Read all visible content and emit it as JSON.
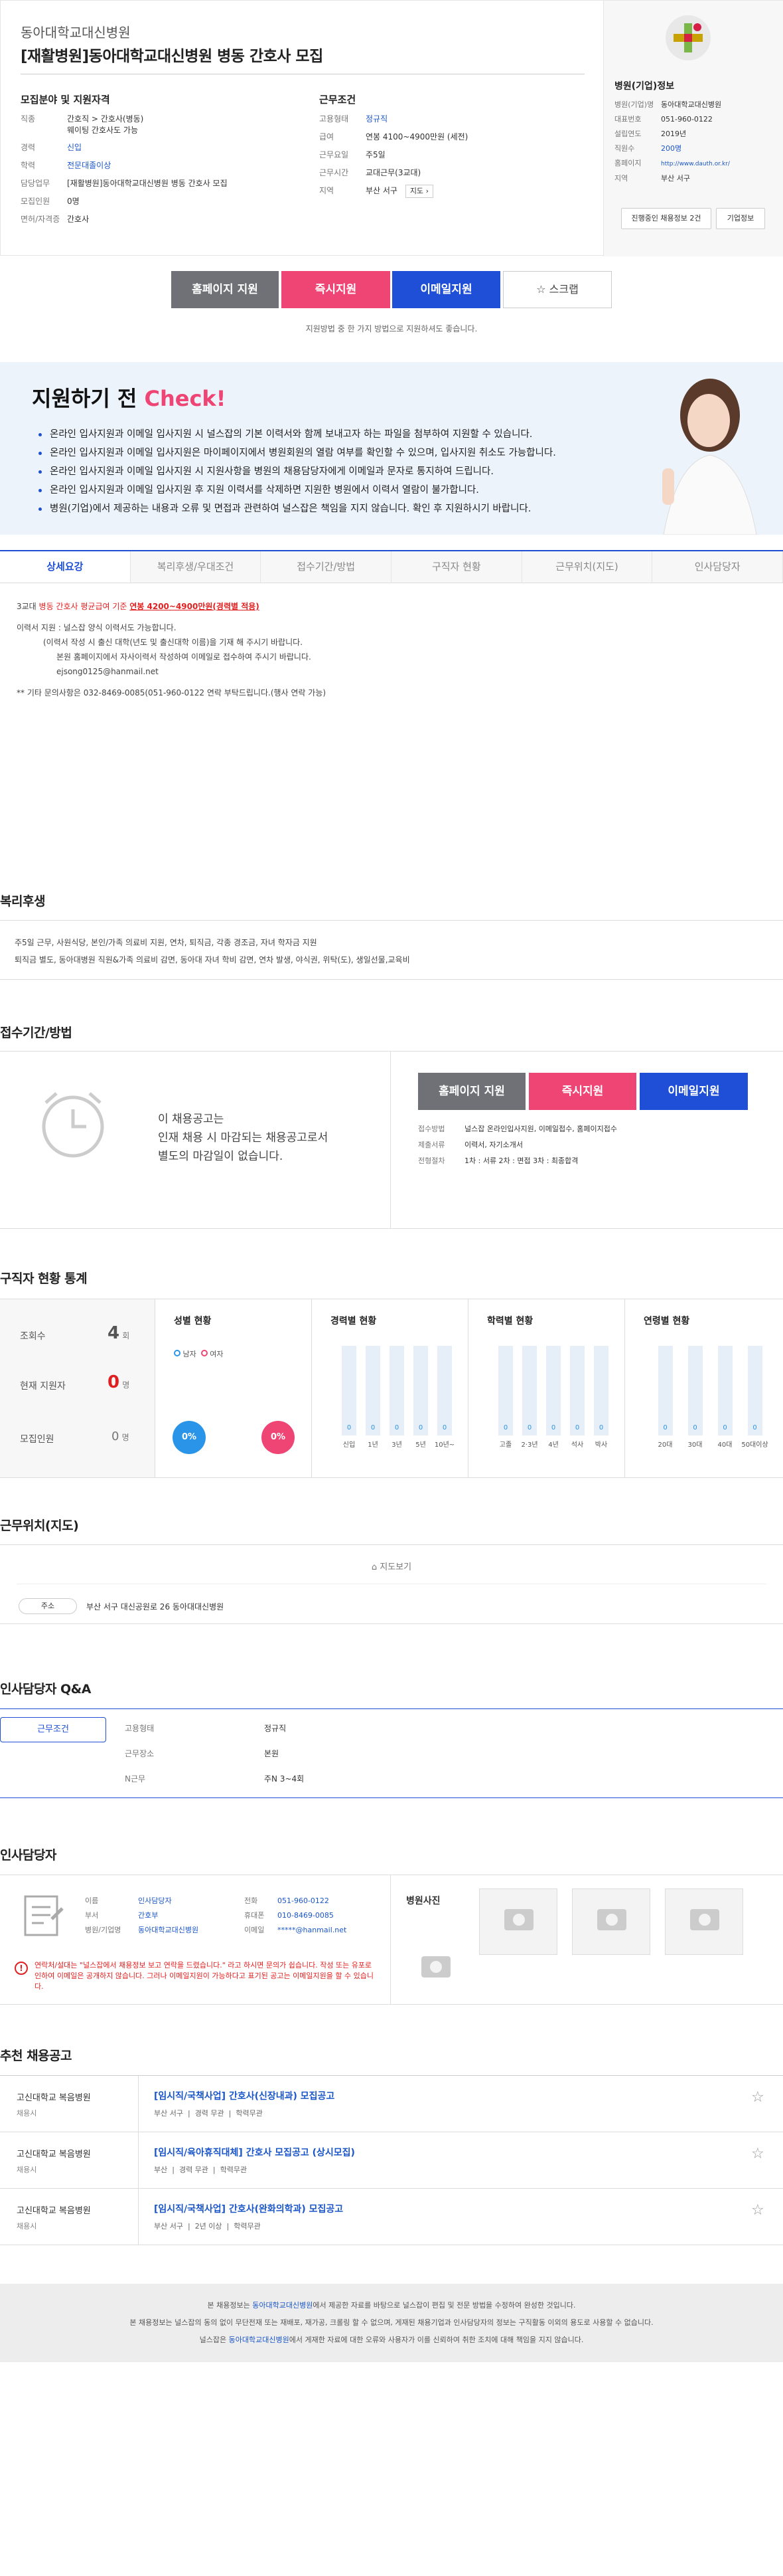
{
  "header": {
    "company": "동아대학교대신병원",
    "title": "[재활병원]동아대학교대신병원 병동 간호사 모집"
  },
  "qual": {
    "heading": "모집분야 및 지원자격",
    "rows": [
      {
        "k": "직종",
        "v": "간호직 > 간호사(병동)",
        "v2": "웨이팅 간호사도 가능"
      },
      {
        "k": "경력",
        "v": "신입"
      },
      {
        "k": "학력",
        "v": "전문대졸이상"
      },
      {
        "k": "담당업무",
        "v": "[재활병원]동아대학교대신병원 병동 간호사 모집"
      },
      {
        "k": "모집인원",
        "v": "0명"
      },
      {
        "k": "면허/자격증",
        "v": "간호사"
      }
    ]
  },
  "cond": {
    "heading": "근무조건",
    "rows": [
      {
        "k": "고용형태",
        "v": "정규직"
      },
      {
        "k": "급여",
        "v": "연봉 4100~4900만원 (세전)"
      },
      {
        "k": "근무요일",
        "v": "주5일"
      },
      {
        "k": "근무시간",
        "v": "교대근무(3교대)"
      },
      {
        "k": "지역",
        "v": "부산 서구",
        "btn": "지도"
      }
    ]
  },
  "hospital": {
    "heading": "병원(기업)정보",
    "rows": [
      {
        "k": "병원(기업)명",
        "v": "동아대학교대신병원"
      },
      {
        "k": "대표번호",
        "v": "051-960-0122"
      },
      {
        "k": "설립연도",
        "v": "2019년"
      },
      {
        "k": "직원수",
        "v": "200명"
      },
      {
        "k": "홈페이지",
        "v": "http://www.dauth.or.kr/"
      },
      {
        "k": "지역",
        "v": "부산 서구"
      }
    ],
    "btn_jobs": "진행중인 채용정보 2건",
    "btn_info": "기업정보"
  },
  "apply": {
    "home": "홈페이지 지원",
    "now": "즉시지원",
    "email": "이메일지원",
    "scrap": "스크랩",
    "note": "지원방법 중 한 가지 방법으로 지원하셔도 좋습니다."
  },
  "check": {
    "title1": "지원하기 전",
    "title2": "Check!",
    "items": [
      "온라인 입사지원과 이메일 입사지원 시 널스잡의 기본 이력서와 함께 보내고자 하는 파일을 첨부하여 지원할 수 있습니다.",
      "온라인 입사지원과 이메일 입사지원은 마이페이지에서 병원회원의 열람 여부를 확인할 수 있으며, 입사지원 취소도 가능합니다.",
      "온라인 입사지원과 이메일 입사지원 시 지원사항을 병원의 채용담당자에게 이메일과 문자로 통지하여 드립니다.",
      "온라인 입사지원과 이메일 입사지원 후 지원 이력서를 삭제하면 지원한 병원에서 이력서 열람이 불가합니다.",
      "병원(기업)에서 제공하는 내용과 오류 및 면접과 관련하여 널스잡은 책임을 지지 않습니다. 확인 후 지원하시기 바랍니다."
    ]
  },
  "tabs": [
    "상세요강",
    "복리후생/우대조건",
    "접수기간/방법",
    "구직자 현황",
    "근무위치(지도)",
    "인사담당자"
  ],
  "detail": {
    "l1a": "3교대 ",
    "l1b": "병동 간호사 평균급여 기준 ",
    "l1c": "연봉 4200~4900만원(경력별 적용)",
    "l2": "이력서 지원 : 널스잡 양식 이력서도 가능합니다.",
    "l3": "(이력서 작성 시 출신 대학(년도 및 출신대학 이름)을 기재 해 주시기 바랍니다.",
    "l4": "본원 홈페이지에서 자사이력서 작성하여 이메일로 접수하여 주시기 바랍니다.",
    "l5": "ejsong0125@hanmail.net",
    "l6": "** 기타 문의사항은 032-8469-0085(051-960-0122 연락 부탁드립니다.(행사 연락 가능)"
  },
  "welfare": {
    "title": "복리후생",
    "l1": "주5일 근무, 사원식당, 본인/가족 의료비 지원, 연차, 퇴직금, 각종 경조금, 자녀 학자금 지원",
    "l2": "퇴직금 별도, 동아대병원 직원&가족 의료비 감면, 동아대 자녀 학비 감면, 연차 발생, 야식권, 위탁(도), 생일선물,교육비"
  },
  "period": {
    "title": "접수기간/방법",
    "msg1": "이 채용공고는",
    "msg2": "인재 채용 시 마감되는 채용공고로서",
    "msg3": "별도의 마감일이 없습니다.",
    "rows": [
      {
        "k": "접수방법",
        "v": "널스잡 온라인입사지원, 이메일접수, 홈페이지접수"
      },
      {
        "k": "제출서류",
        "v": "이력서, 자기소개서"
      },
      {
        "k": "전형절차",
        "v": "1차 : 서류   2차 : 면접   3차 : 최종합격"
      }
    ]
  },
  "stats": {
    "title": "구직자 현황 통계",
    "views_k": "조회수",
    "views_v": "4",
    "views_u": "회",
    "apps_k": "현재 지원자",
    "apps_v": "0",
    "apps_u": "명",
    "rec_k": "모집인원",
    "rec_v": "0",
    "rec_u": "명",
    "gender": {
      "title": "성별 현황",
      "male": "남자",
      "female": "여자",
      "male_pct": "0%",
      "female_pct": "0%"
    },
    "career": {
      "title": "경력별 현황",
      "labels": [
        "신입",
        "1년",
        "3년",
        "5년",
        "10년~"
      ]
    },
    "edu": {
      "title": "학력별 현황",
      "labels": [
        "고졸",
        "2·3년",
        "4년",
        "석사",
        "박사"
      ]
    },
    "age": {
      "title": "연령별 현황",
      "labels": [
        "20대",
        "30대",
        "40대",
        "50대이상"
      ]
    }
  },
  "loc": {
    "title": "근무위치(지도)",
    "mapbtn": "지도보기",
    "addr_k": "주소",
    "addr_v": "부산 서구 대신공원로 26 동아대대신병원"
  },
  "qa": {
    "title": "인사담당자 Q&A",
    "tab": "근무조건",
    "rows": [
      {
        "k": "고용형태",
        "v": "정규직"
      },
      {
        "k": "근무장소",
        "v": "본원"
      },
      {
        "k": "N근무",
        "v": "주N 3~4회"
      }
    ]
  },
  "hr": {
    "title": "인사담당자",
    "rows": [
      {
        "k": "이름",
        "v": "인사담당자"
      },
      {
        "k": "부서",
        "v": "간호부"
      },
      {
        "k": "병원/기업명",
        "v": "동아대학교대신병원"
      }
    ],
    "rows2": [
      {
        "k": "전화",
        "v": "051-960-0122"
      },
      {
        "k": "휴대폰",
        "v": "010-8469-0085"
      },
      {
        "k": "이메일",
        "v": "*****@hanmail.net"
      }
    ],
    "warn": "연락처/설대는 \"널스잡에서 채용정보 보고 연락을 드렸습니다.\" 라고 하시면 문의가 쉽습니다. 작성 또는 유포로 인하여 이메일은 공개하지 않습니다. 그러나 이메일지원이 가능하다고 표기된 공고는 이메일지원을 할 수 있습니다.",
    "photo": "병원사진"
  },
  "rec": {
    "title": "추천 채용공고",
    "items": [
      {
        "co": "고신대학교 복음병원",
        "type": "채용시",
        "t": "[임시직/국책사업] 간호사(신장내과) 모집공고",
        "meta": [
          "부산 서구",
          "경력 무관",
          "학력무관"
        ]
      },
      {
        "co": "고신대학교 복음병원",
        "type": "채용시",
        "t": "[임시직/육아휴직대체] 간호사 모집공고 (상시모집)",
        "meta": [
          "부산",
          "경력 무관",
          "학력무관"
        ]
      },
      {
        "co": "고신대학교 복음병원",
        "type": "채용시",
        "t": "[임시직/국책사업] 간호사(완화의학과) 모집공고",
        "meta": [
          "부산 서구",
          "2년 이상",
          "학력무관"
        ]
      }
    ]
  },
  "footer": {
    "l1a": "본 채용정보는 ",
    "l1b": "동아대학교대신병원",
    "l1c": "에서 제공한 자료를 바탕으로 널스잡이 편집 및 전문 방법을 수정하여 완성한 것입니다.",
    "l2": "본 채용정보는 널스잡의 동의 없이 무단전재 또는 재배포, 재가공, 크롤링 할 수 없으며, 게재된 채용기업과 인사담당자의 정보는 구직활동 이외의 용도로 사용할 수 없습니다.",
    "l3a": "널스잡은 ",
    "l3b": "동아대학교대신병원",
    "l3c": "에서 게재한 자료에 대한 오류와 사용자가 이를 신뢰하여 취한 조치에 대해 책임을 지지 않습니다."
  }
}
